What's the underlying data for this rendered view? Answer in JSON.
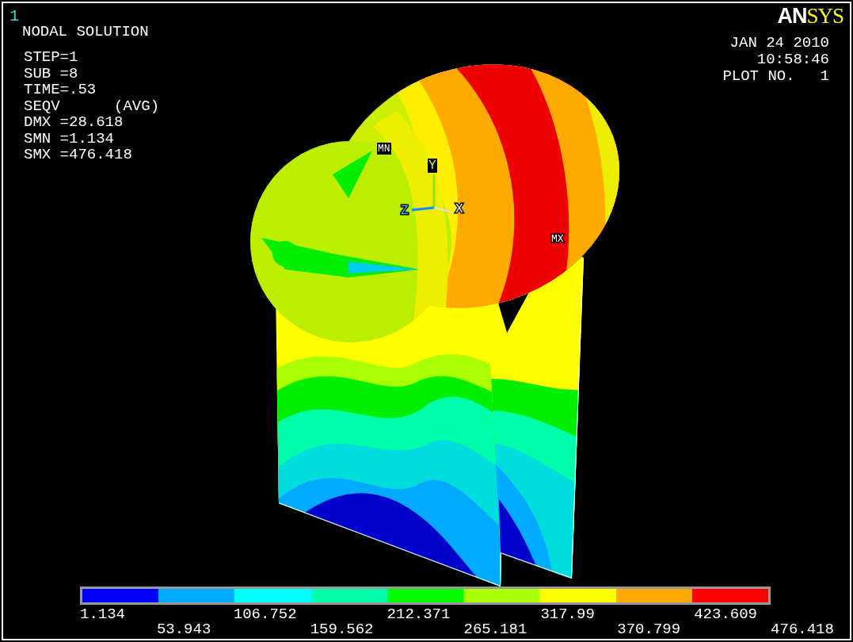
{
  "window_number": "1",
  "title": "NODAL SOLUTION",
  "info_lines": [
    "STEP=1",
    "SUB =8",
    "TIME=.53",
    "SEQV      (AVG)",
    "DMX =28.618",
    "SMN =1.134",
    "SMX =476.418"
  ],
  "logo": {
    "part_1": "AN",
    "part_2": "SYS"
  },
  "date": "JAN 24 2010",
  "time": "10:58:46",
  "plot_label": "PLOT NO.",
  "plot_number": "1",
  "markers": {
    "min": "MN",
    "max": "MX"
  },
  "triad": {
    "x": "X",
    "y": "Y",
    "z": "Z"
  },
  "legend": {
    "bands": [
      {
        "color": "#0000ff"
      },
      {
        "color": "#00aaff"
      },
      {
        "color": "#00ffff"
      },
      {
        "color": "#00ffaa"
      },
      {
        "color": "#00ff00"
      },
      {
        "color": "#aaff00"
      },
      {
        "color": "#ffff00"
      },
      {
        "color": "#ffaa00"
      },
      {
        "color": "#ff0000"
      }
    ],
    "labels": [
      "1.134",
      "53.943",
      "106.752",
      "159.562",
      "212.371",
      "265.181",
      "317.99",
      "370.799",
      "423.609",
      "476.418"
    ]
  }
}
